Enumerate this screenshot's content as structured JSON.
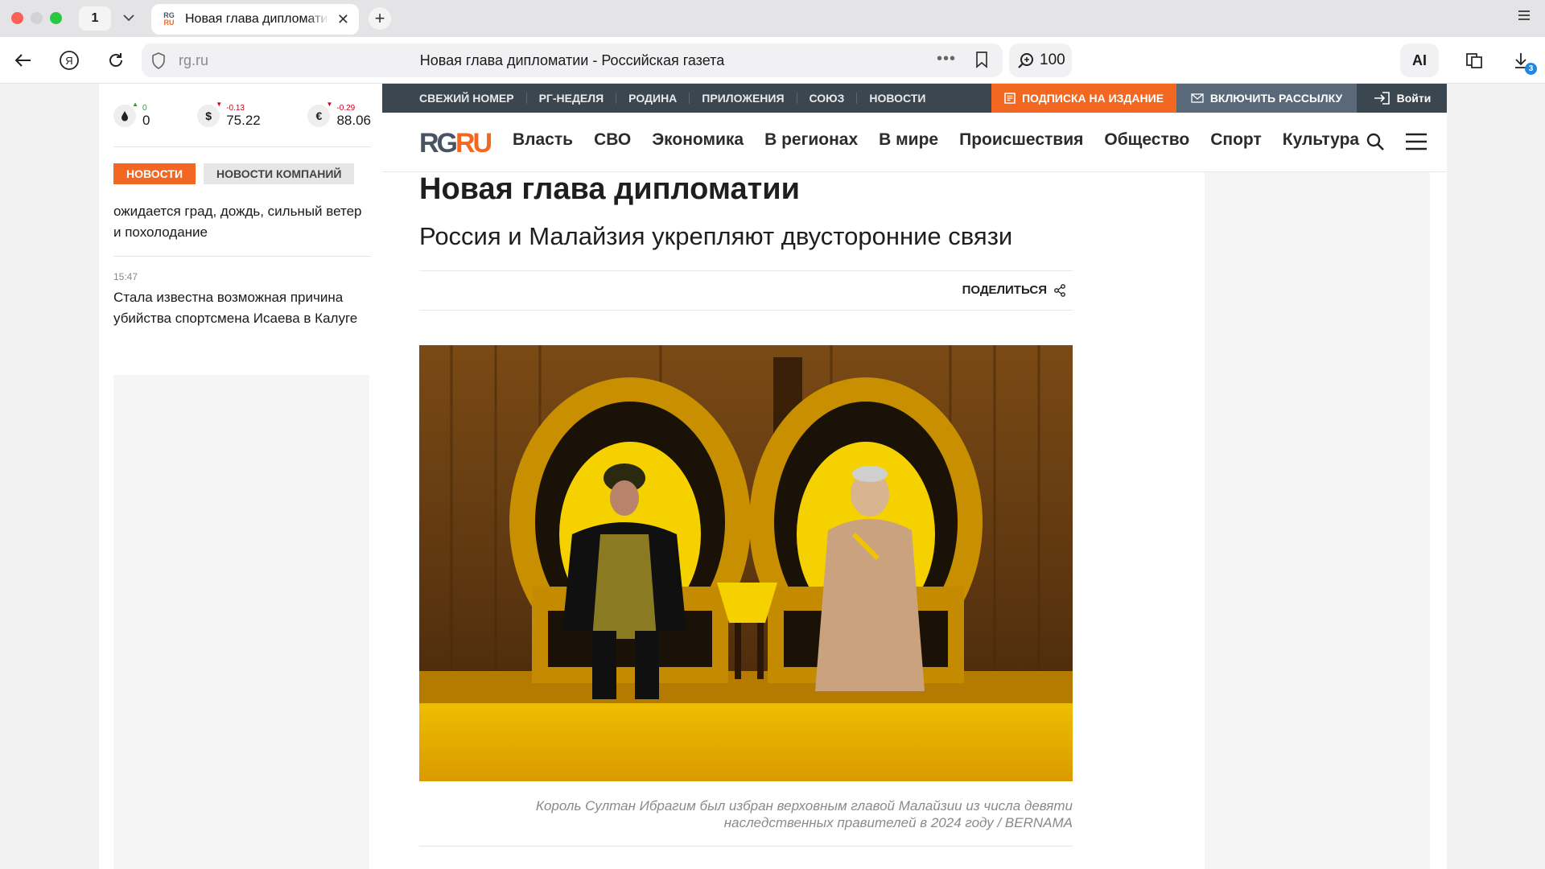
{
  "browser": {
    "tab_count": "1",
    "tab_title": "Новая глава дипломатии",
    "url_host": "rg.ru",
    "page_title": "Новая глава дипломатии - Российская газета",
    "zoom": "100",
    "ai_label": "AI",
    "downloads_badge": "3"
  },
  "ticker": [
    {
      "icon": "oil-drop-icon",
      "symbol": "💧",
      "delta": "0",
      "value": "0",
      "trend": "up",
      "color": "#2e9e2e"
    },
    {
      "icon": "dollar-icon",
      "symbol": "$",
      "delta": "-0.13",
      "value": "75.22",
      "trend": "down",
      "color": "#d0021b"
    },
    {
      "icon": "euro-icon",
      "symbol": "€",
      "delta": "-0.29",
      "value": "88.06",
      "trend": "down",
      "color": "#d0021b"
    }
  ],
  "news_tabs": {
    "news": "НОВОСТИ",
    "company_news": "НОВОСТИ КОМПАНИЙ"
  },
  "news_items": [
    {
      "time": "",
      "text": "ожидается град, дождь, сильный ветер и похолодание"
    },
    {
      "time": "15:47",
      "text": "Стала известна возможная причина убийства спортсмена Исаева в Калуге"
    }
  ],
  "top_strip": {
    "links": [
      "СВЕЖИЙ НОМЕР",
      "РГ-НЕДЕЛЯ",
      "РОДИНА",
      "ПРИЛОЖЕНИЯ",
      "СОЮЗ",
      "НОВОСТИ"
    ],
    "subscribe": "ПОДПИСКА НА ИЗДАНИЕ",
    "newsletter": "ВКЛЮЧИТЬ РАССЫЛКУ",
    "login": "Войти"
  },
  "logo": {
    "part1": "RG",
    "part2": "RU"
  },
  "menu": [
    "Власть",
    "СВО",
    "Экономика",
    "В регионах",
    "В мире",
    "Происшествия",
    "Общество",
    "Спорт",
    "Культура"
  ],
  "article": {
    "title": "Новая глава дипломатии",
    "subtitle": "Россия и Малайзия укрепляют двусторонние связи",
    "share_label": "ПОДЕЛИТЬСЯ",
    "caption_line1": "Король Султан Ибрагим был избран верховным главой Малайзии из числа девяти",
    "caption_line2": "наследственных правителей в 2024 году / BERNAMA"
  },
  "colors": {
    "brand_orange": "#f26722",
    "strip_dark": "#3a4650",
    "strip_mid": "#59697a",
    "logo_gray": "#4a5361"
  }
}
